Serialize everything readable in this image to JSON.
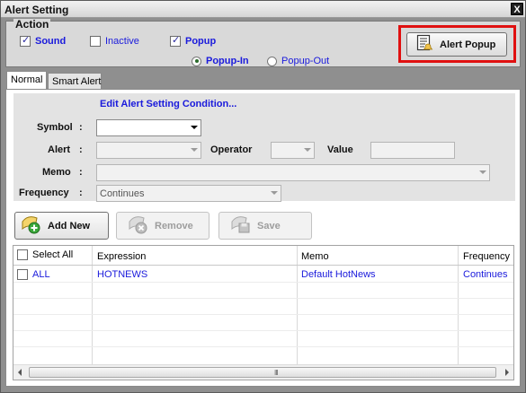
{
  "window": {
    "title": "Alert Setting",
    "close_label": "X"
  },
  "action": {
    "legend": "Action",
    "sound": {
      "label": "Sound",
      "checked": true
    },
    "inactive": {
      "label": "Inactive",
      "checked": false
    },
    "popup": {
      "label": "Popup",
      "checked": true
    },
    "popup_in": {
      "label": "Popup-In",
      "selected": true
    },
    "popup_out": {
      "label": "Popup-Out",
      "selected": false
    },
    "alert_popup_button": "Alert Popup"
  },
  "tabs": [
    {
      "label": "Normal",
      "active": true
    },
    {
      "label": "Smart Alert",
      "active": false
    }
  ],
  "condition": {
    "title": "Edit Alert Setting Condition...",
    "symbol_label": "Symbol",
    "symbol_value": "",
    "alert_label": "Alert",
    "alert_value": "",
    "operator_label": "Operator",
    "operator_value": "",
    "value_label": "Value",
    "value_value": "",
    "memo_label": "Memo",
    "memo_value": "",
    "frequency_label": "Frequency",
    "frequency_value": "Continues",
    "colon": ":"
  },
  "buttons": {
    "add_new": "Add New",
    "remove": "Remove",
    "save": "Save"
  },
  "grid": {
    "select_all_label": "Select All",
    "columns": [
      "Expression",
      "Memo",
      "Frequency"
    ],
    "rows": [
      {
        "symbol": "ALL",
        "expression": "HOTNEWS",
        "memo": "Default HotNews",
        "frequency": "Continues"
      }
    ],
    "scroll_grip": "III"
  }
}
